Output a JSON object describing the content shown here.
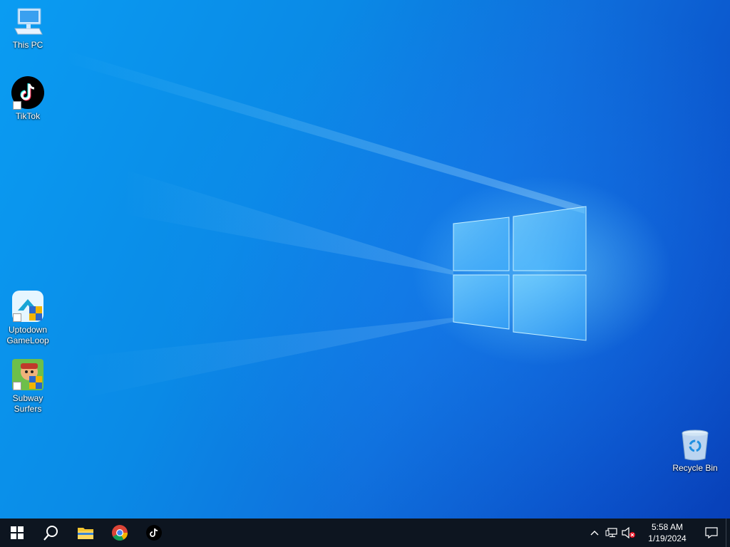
{
  "desktop": {
    "icons": [
      {
        "label": "This PC",
        "icon": "computer-icon"
      },
      {
        "label": "TikTok",
        "icon": "tiktok-icon"
      },
      {
        "label": "Uptodown GameLoop",
        "icon": "gameloop-icon"
      },
      {
        "label": "Subway Surfers",
        "icon": "subway-surfers-icon"
      },
      {
        "label": "Recycle Bin",
        "icon": "recycle-bin-icon"
      }
    ]
  },
  "taskbar": {
    "pinned": [
      {
        "name": "start",
        "icon": "windows-logo-icon"
      },
      {
        "name": "search",
        "icon": "search-icon"
      },
      {
        "name": "file-explorer",
        "icon": "folder-icon"
      },
      {
        "name": "chrome",
        "icon": "chrome-icon"
      },
      {
        "name": "tiktok",
        "icon": "tiktok-icon"
      }
    ],
    "tray": {
      "time": "5:58 AM",
      "date": "1/19/2024"
    }
  },
  "colors": {
    "taskbar": "#0d1520",
    "accent": "#0a8ae6"
  }
}
